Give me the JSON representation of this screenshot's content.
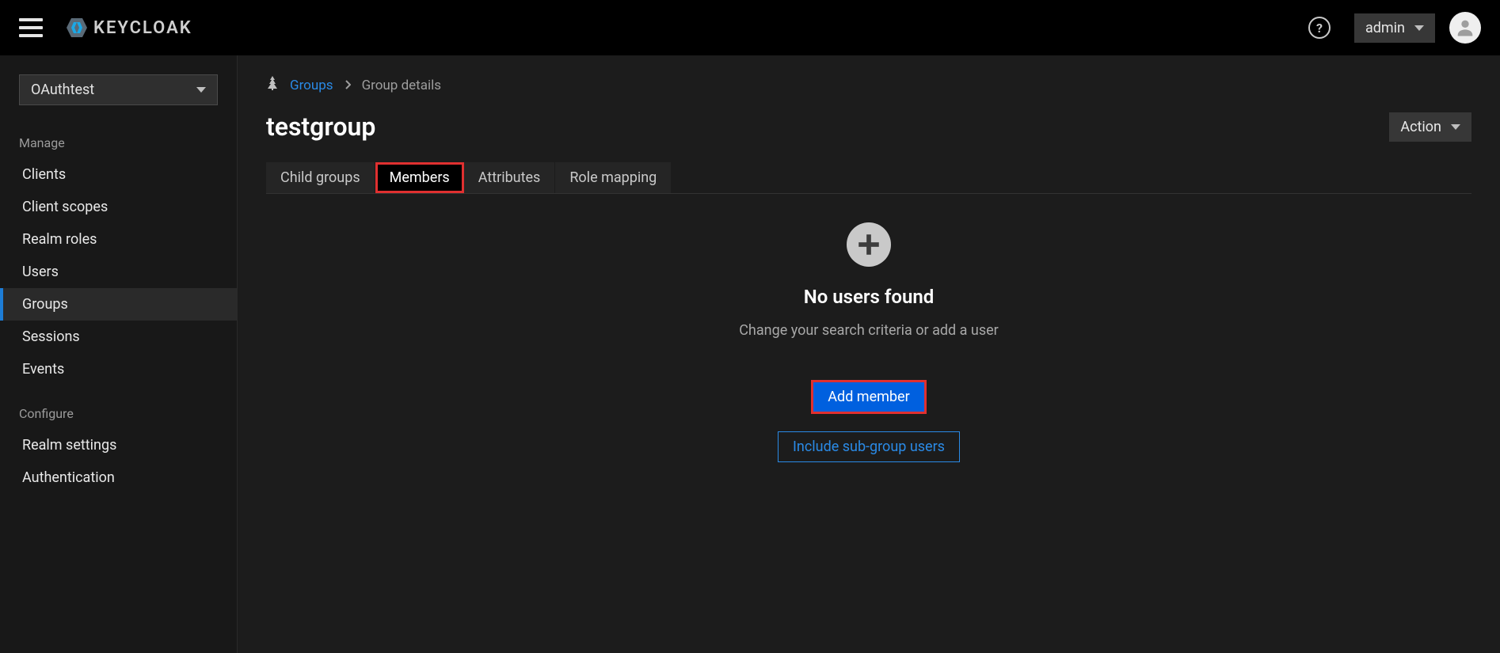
{
  "header": {
    "brand": "KEYCLOAK",
    "user": "admin"
  },
  "sidebar": {
    "realm": "OAuthtest",
    "sections": [
      {
        "label": "Manage",
        "items": [
          "Clients",
          "Client scopes",
          "Realm roles",
          "Users",
          "Groups",
          "Sessions",
          "Events"
        ],
        "active_index": 4
      },
      {
        "label": "Configure",
        "items": [
          "Realm settings",
          "Authentication"
        ]
      }
    ]
  },
  "breadcrumb": {
    "root": "Groups",
    "current": "Group details"
  },
  "page": {
    "title": "testgroup",
    "action_label": "Action"
  },
  "tabs": {
    "items": [
      "Child groups",
      "Members",
      "Attributes",
      "Role mapping"
    ],
    "active_index": 1
  },
  "empty_state": {
    "title": "No users found",
    "subtitle": "Change your search criteria or add a user",
    "primary_btn": "Add member",
    "secondary_btn": "Include sub-group users"
  }
}
